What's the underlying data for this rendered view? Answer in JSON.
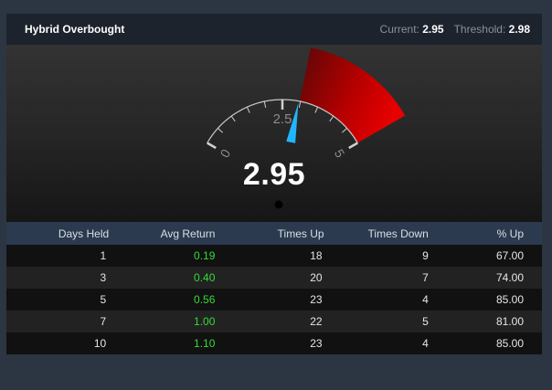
{
  "header": {
    "title": "Hybrid Overbought",
    "current_label": "Current:",
    "current_value": "2.95",
    "threshold_label": "Threshold:",
    "threshold_value": "2.98"
  },
  "gauge": {
    "min": 0,
    "max": 5,
    "mid_label": "2.5",
    "min_label": "0",
    "max_label": "5",
    "value": 2.95,
    "value_text": "2.95",
    "zone_start": 2.98,
    "zone_color": "#c80000",
    "needle_color": "#1fb6ff"
  },
  "table": {
    "headers": [
      "Days Held",
      "Avg Return",
      "Times Up",
      "Times Down",
      "% Up"
    ],
    "rows": [
      [
        "1",
        "0.19",
        "18",
        "9",
        "67.00"
      ],
      [
        "3",
        "0.40",
        "20",
        "7",
        "74.00"
      ],
      [
        "5",
        "0.56",
        "23",
        "4",
        "85.00"
      ],
      [
        "7",
        "1.00",
        "22",
        "5",
        "81.00"
      ],
      [
        "10",
        "1.10",
        "23",
        "4",
        "85.00"
      ]
    ]
  }
}
